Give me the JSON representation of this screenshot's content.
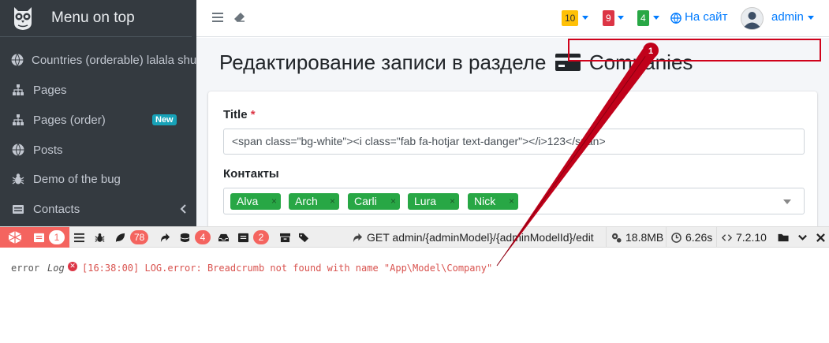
{
  "brand": {
    "title": "Menu on top"
  },
  "sidebar": {
    "items": [
      {
        "label": "Countries (orderable) lalala shu",
        "icon": "globe-icon"
      },
      {
        "label": "Pages",
        "icon": "sitemap-icon"
      },
      {
        "label": "Pages (order)",
        "icon": "sitemap-icon",
        "badge": "New"
      },
      {
        "label": "Posts",
        "icon": "globe-icon"
      },
      {
        "label": "Demo of the bug",
        "icon": "bug-icon"
      },
      {
        "label": "Contacts",
        "icon": "contacts-icon"
      }
    ]
  },
  "topbar": {
    "badges": [
      {
        "count": "10",
        "color": "#ffc107"
      },
      {
        "count": "9",
        "color": "#dc3545"
      },
      {
        "count": "4",
        "color": "#28a745"
      }
    ],
    "site_link": "На сайт",
    "user": "admin"
  },
  "page": {
    "title": "Редактирование записи в разделе",
    "section": "Companies"
  },
  "form": {
    "title_label": "Title",
    "required_mark": "*",
    "title_value": "<span class=\"bg-white\"><i class=\"fab fa-hotjar text-danger\"></i>123</span>",
    "contacts_label": "Контакты",
    "contacts": [
      "Alva",
      "Arch",
      "Carli",
      "Lura",
      "Nick"
    ],
    "tag_remove": "×"
  },
  "debugbar": {
    "messages_count": "1",
    "views_count": "78",
    "queries_count": "4",
    "mails_count": "2",
    "request": "GET admin/{adminModel}/{adminModelId}/edit",
    "memory": "18.8MB",
    "time": "6.26s",
    "php_version": "7.2.10"
  },
  "log": {
    "level": "error",
    "label": "Log",
    "message": "[16:38:00] LOG.error: Breadcrumb not found with name \"App\\Model\\Company\""
  },
  "annotation": {
    "number": "1",
    "color": "#d0021b"
  }
}
